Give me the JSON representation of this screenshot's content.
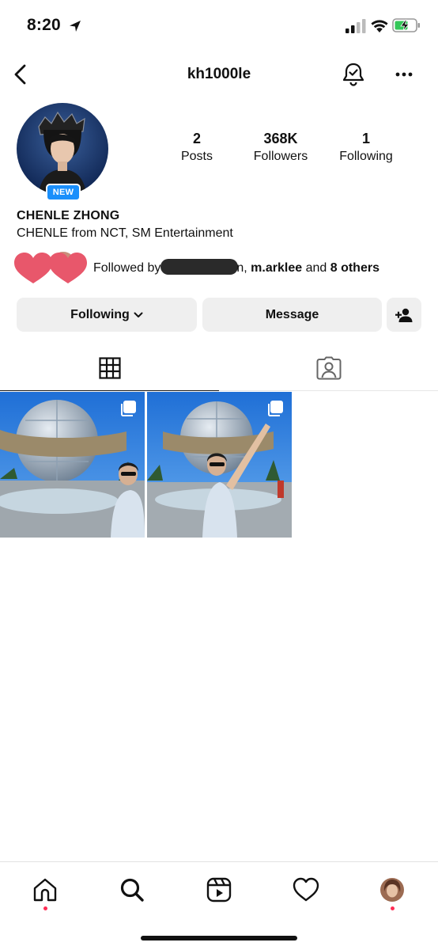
{
  "status": {
    "time": "8:20"
  },
  "nav": {
    "username": "kh1000le"
  },
  "profile": {
    "badge": "NEW",
    "name": "CHENLE ZHONG",
    "bio": "CHENLE from NCT, SM Entertainment",
    "stats": [
      {
        "value": "2",
        "label": "Posts"
      },
      {
        "value": "368K",
        "label": "Followers"
      },
      {
        "value": "1",
        "label": "Following"
      }
    ],
    "followed_by": {
      "prefix": "Followed by",
      "name_tail": "n,",
      "name2": "m.arklee",
      "and": "and",
      "others": "8 others"
    }
  },
  "buttons": {
    "following": "Following",
    "message": "Message"
  },
  "tabs": [
    {
      "icon": "grid-icon",
      "selected": true
    },
    {
      "icon": "tagged-person-icon",
      "selected": false
    }
  ],
  "posts": [
    {
      "icon": "multiple-photos-icon",
      "scene": "Universal Studios globe, person with sunglasses"
    },
    {
      "icon": "multiple-photos-icon",
      "scene": "Universal Studios globe, person raising arm"
    }
  ],
  "bottom_nav": [
    {
      "icon": "home-icon",
      "active": true
    },
    {
      "icon": "search-icon",
      "active": false
    },
    {
      "icon": "reels-icon",
      "active": false
    },
    {
      "icon": "heart-icon",
      "active": false
    },
    {
      "icon": "profile-avatar",
      "active": false
    }
  ],
  "colors": {
    "badge_blue": "#1a8ffb",
    "button_gray": "#efefef",
    "notification_red": "#ff2d55",
    "heart_pink": "#e8576b"
  }
}
